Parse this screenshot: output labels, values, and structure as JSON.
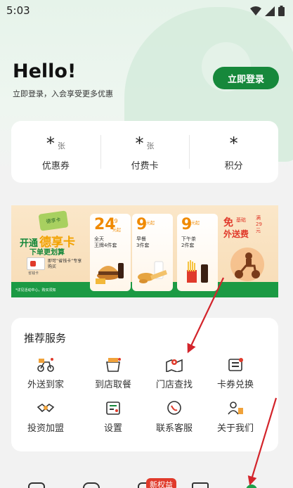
{
  "status_bar": {
    "time": "5:03"
  },
  "header": {
    "greeting": "Hello!",
    "subtitle": "立即登录，入会享受更多优惠",
    "login_label": "立即登录"
  },
  "stats": [
    {
      "value": "*",
      "unit": "张",
      "label": "优惠券"
    },
    {
      "value": "*",
      "unit": "张",
      "label": "付费卡"
    },
    {
      "value": "*",
      "unit": "",
      "label": "积分"
    }
  ],
  "banner": {
    "title_prefix": "开通",
    "title_card": "德享卡",
    "subtitle": "下单更划算",
    "card_image_text": "德享卡",
    "card_name": "即可“省钱卡”专享购买",
    "card_sub": "省钱卡",
    "footnote": "*详见活动中心，购买须知",
    "deals": [
      {
        "num": "24",
        "frac": ".9",
        "unit": "元起",
        "name": "全天\n王牌4件套"
      },
      {
        "num": "9",
        "frac": "",
        "unit": "元起",
        "name": "早餐\n3件套"
      },
      {
        "num": "9",
        "frac": "",
        "unit": "元起",
        "name": "下午茶\n2件套"
      }
    ],
    "delivery": {
      "free": "免",
      "basic": "基础",
      "threshold": "满\n29\n元",
      "fee": "外送费"
    }
  },
  "services": {
    "title": "推荐服务",
    "items": [
      {
        "label": "外送到家",
        "icon": "delivery-scooter-icon"
      },
      {
        "label": "到店取餐",
        "icon": "pickup-bag-icon"
      },
      {
        "label": "门店查找",
        "icon": "store-map-icon"
      },
      {
        "label": "卡券兑换",
        "icon": "coupon-exchange-icon"
      },
      {
        "label": "投资加盟",
        "icon": "handshake-icon"
      },
      {
        "label": "设置",
        "icon": "settings-icon"
      },
      {
        "label": "联系客服",
        "icon": "customer-service-icon"
      },
      {
        "label": "关于我们",
        "icon": "about-us-icon"
      }
    ]
  },
  "bottom_nav": {
    "badge": "新权益"
  },
  "colors": {
    "brand_green": "#16883b",
    "accent_red": "#e03a2b",
    "accent_orange": "#f08a00"
  }
}
